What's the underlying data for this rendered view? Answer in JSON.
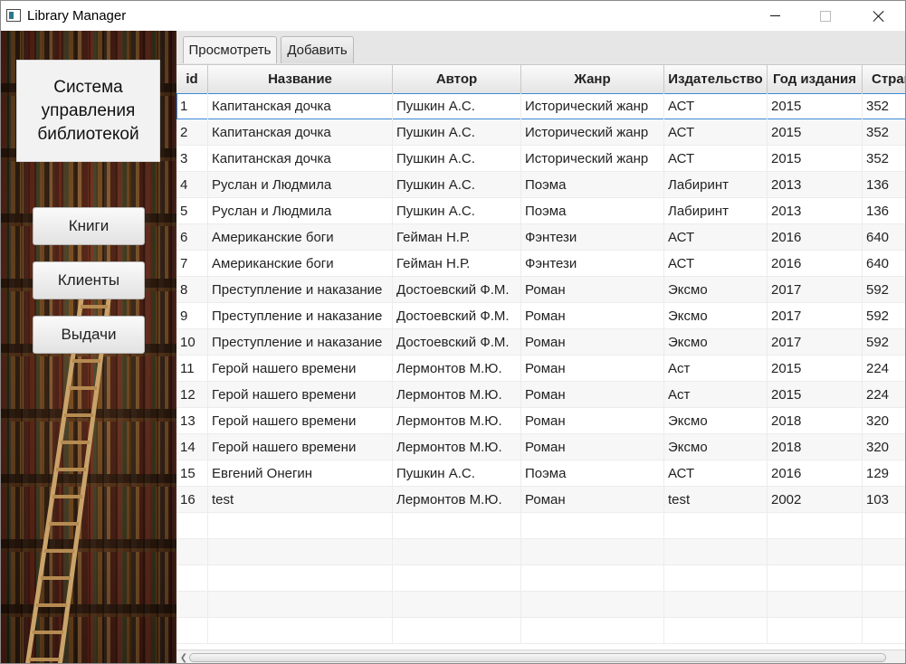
{
  "window": {
    "title": "Library Manager"
  },
  "sidebar": {
    "system_title_lines": [
      "Система",
      "управления",
      "библиотекой"
    ],
    "buttons": {
      "books": "Книги",
      "clients": "Клиенты",
      "loans": "Выдачи"
    }
  },
  "tabs": {
    "view": "Просмотреть",
    "add": "Добавить"
  },
  "table": {
    "columns": [
      "id",
      "Название",
      "Автор",
      "Жанр",
      "Издательство",
      "Год издания",
      "Стран"
    ],
    "rows": [
      [
        "1",
        "Капитанская дочка",
        "Пушкин А.С.",
        "Исторический жанр",
        "АСТ",
        "2015",
        "352"
      ],
      [
        "2",
        "Капитанская дочка",
        "Пушкин А.С.",
        "Исторический жанр",
        "АСТ",
        "2015",
        "352"
      ],
      [
        "3",
        "Капитанская дочка",
        "Пушкин А.С.",
        "Исторический жанр",
        "АСТ",
        "2015",
        "352"
      ],
      [
        "4",
        "Руслан и Людмила",
        "Пушкин А.С.",
        "Поэма",
        "Лабиринт",
        "2013",
        "136"
      ],
      [
        "5",
        "Руслан и Людмила",
        "Пушкин А.С.",
        "Поэма",
        "Лабиринт",
        "2013",
        "136"
      ],
      [
        "6",
        "Американские боги",
        "Гейман Н.Р.",
        "Фэнтези",
        "АСТ",
        "2016",
        "640"
      ],
      [
        "7",
        "Американские боги",
        "Гейман Н.Р.",
        "Фэнтези",
        "АСТ",
        "2016",
        "640"
      ],
      [
        "8",
        "Преступление и наказание",
        "Достоевский Ф.М.",
        "Роман",
        "Эксмо",
        "2017",
        "592"
      ],
      [
        "9",
        "Преступление и наказание",
        "Достоевский Ф.М.",
        "Роман",
        "Эксмо",
        "2017",
        "592"
      ],
      [
        "10",
        "Преступление и наказание",
        "Достоевский Ф.М.",
        "Роман",
        "Эксмо",
        "2017",
        "592"
      ],
      [
        "11",
        "Герой нашего времени",
        "Лермонтов М.Ю.",
        "Роман",
        "Аст",
        "2015",
        "224"
      ],
      [
        "12",
        "Герой нашего времени",
        "Лермонтов М.Ю.",
        "Роман",
        "Аст",
        "2015",
        "224"
      ],
      [
        "13",
        "Герой нашего времени",
        "Лермонтов М.Ю.",
        "Роман",
        "Эксмо",
        "2018",
        "320"
      ],
      [
        "14",
        "Герой нашего времени",
        "Лермонтов М.Ю.",
        "Роман",
        "Эксмо",
        "2018",
        "320"
      ],
      [
        "15",
        "Евгений Онегин",
        "Пушкин А.С.",
        "Поэма",
        "АСТ",
        "2016",
        "129"
      ],
      [
        "16",
        "test",
        "Лермонтов М.Ю.",
        "Роман",
        "test",
        "2002",
        "103"
      ]
    ]
  },
  "colors": {
    "selection_outline": "#3a8ad6"
  },
  "icons": {
    "app": "app-window-icon",
    "minimize": "minimize-icon",
    "maximize": "maximize-icon",
    "close": "close-icon",
    "scroll_left": "chevron-left-icon"
  }
}
